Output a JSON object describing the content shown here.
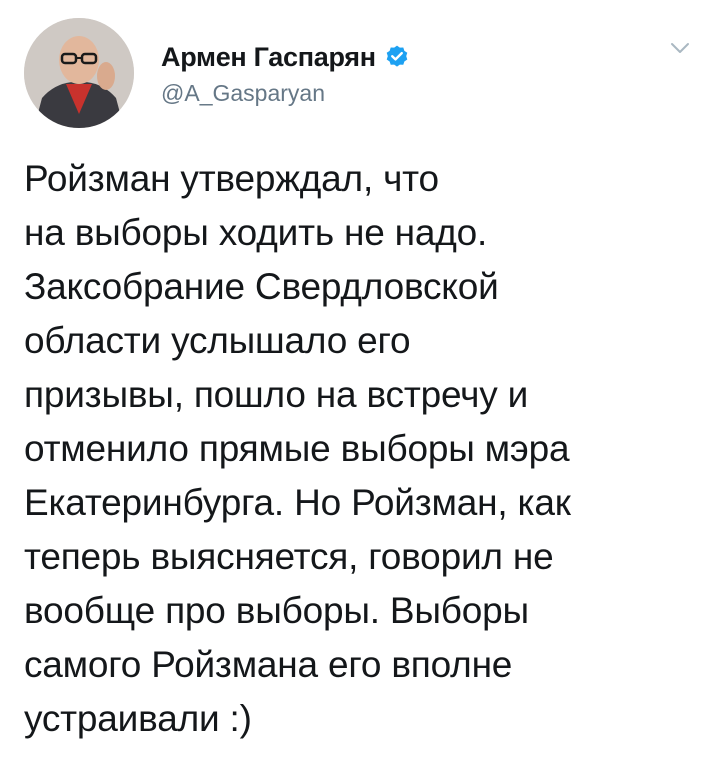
{
  "author": {
    "display_name": "Армен Гаспарян",
    "handle": "@A_Gasparyan",
    "verified": true,
    "avatar_icon": "profile-photo"
  },
  "menu_icon": "chevron-down-icon",
  "tweet": {
    "text": "Ройзман утверждал, что\nна выборы ходить не надо.\nЗаксобрание Свердловской\nобласти услышало его\nпризывы, пошло на встречу и\nотменило прямые выборы мэра\nЕкатеринбурга. Но Ройзман, как\nтеперь выясняется, говорил не\nвообще про выборы. Выборы\nсамого Ройзмана его вполне\nустраивали :)"
  },
  "colors": {
    "text_primary": "#14171a",
    "text_secondary": "#657786",
    "verified_blue": "#1da1f2",
    "chevron": "#aab8c2"
  }
}
